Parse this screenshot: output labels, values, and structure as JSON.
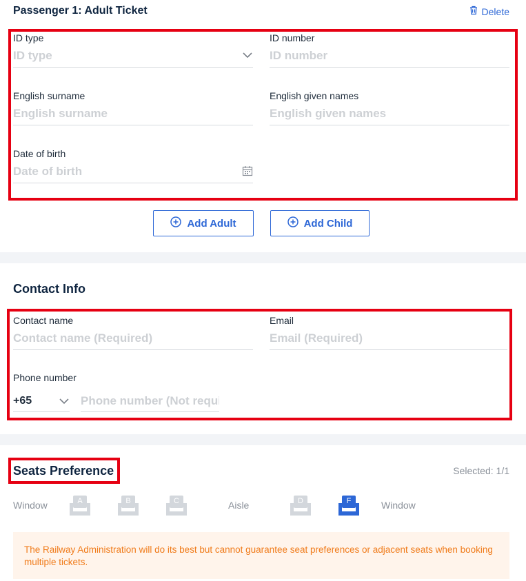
{
  "passenger": {
    "title": "Passenger 1: Adult Ticket",
    "delete_label": "Delete",
    "id_type": {
      "label": "ID type",
      "placeholder": "ID type"
    },
    "id_number": {
      "label": "ID number",
      "placeholder": "ID number"
    },
    "surname": {
      "label": "English surname",
      "placeholder": "English surname"
    },
    "given_names": {
      "label": "English given names",
      "placeholder": "English given names"
    },
    "dob": {
      "label": "Date of birth",
      "placeholder": "Date of birth"
    },
    "add_adult_label": "Add Adult",
    "add_child_label": "Add Child"
  },
  "contact": {
    "title": "Contact Info",
    "name": {
      "label": "Contact name",
      "placeholder": "Contact name (Required)"
    },
    "email": {
      "label": "Email",
      "placeholder": "Email (Required)"
    },
    "phone": {
      "label": "Phone number",
      "country_code": "+65",
      "placeholder": "Phone number (Not required)"
    }
  },
  "seats": {
    "title": "Seats Preference",
    "selected_text": "Selected: 1/1",
    "window_left": "Window",
    "aisle": "Aisle",
    "window_right": "Window",
    "options": [
      {
        "letter": "A",
        "selected": false
      },
      {
        "letter": "B",
        "selected": false
      },
      {
        "letter": "C",
        "selected": false
      },
      {
        "letter": "D",
        "selected": false
      },
      {
        "letter": "F",
        "selected": true
      }
    ],
    "notice": "The Railway Administration will do its best but cannot guarantee seat preferences or adjacent seats when booking multiple tickets."
  },
  "colors": {
    "accent": "#2d67d6",
    "highlight_box": "#e60012",
    "seat_unselected": "#d3d7dc",
    "notice_text": "#f07b1a",
    "notice_bg": "#fff4eb"
  },
  "icons": [
    "trash-icon",
    "chevron-down-icon",
    "calendar-icon",
    "plus-circle-icon",
    "seat-icon"
  ]
}
